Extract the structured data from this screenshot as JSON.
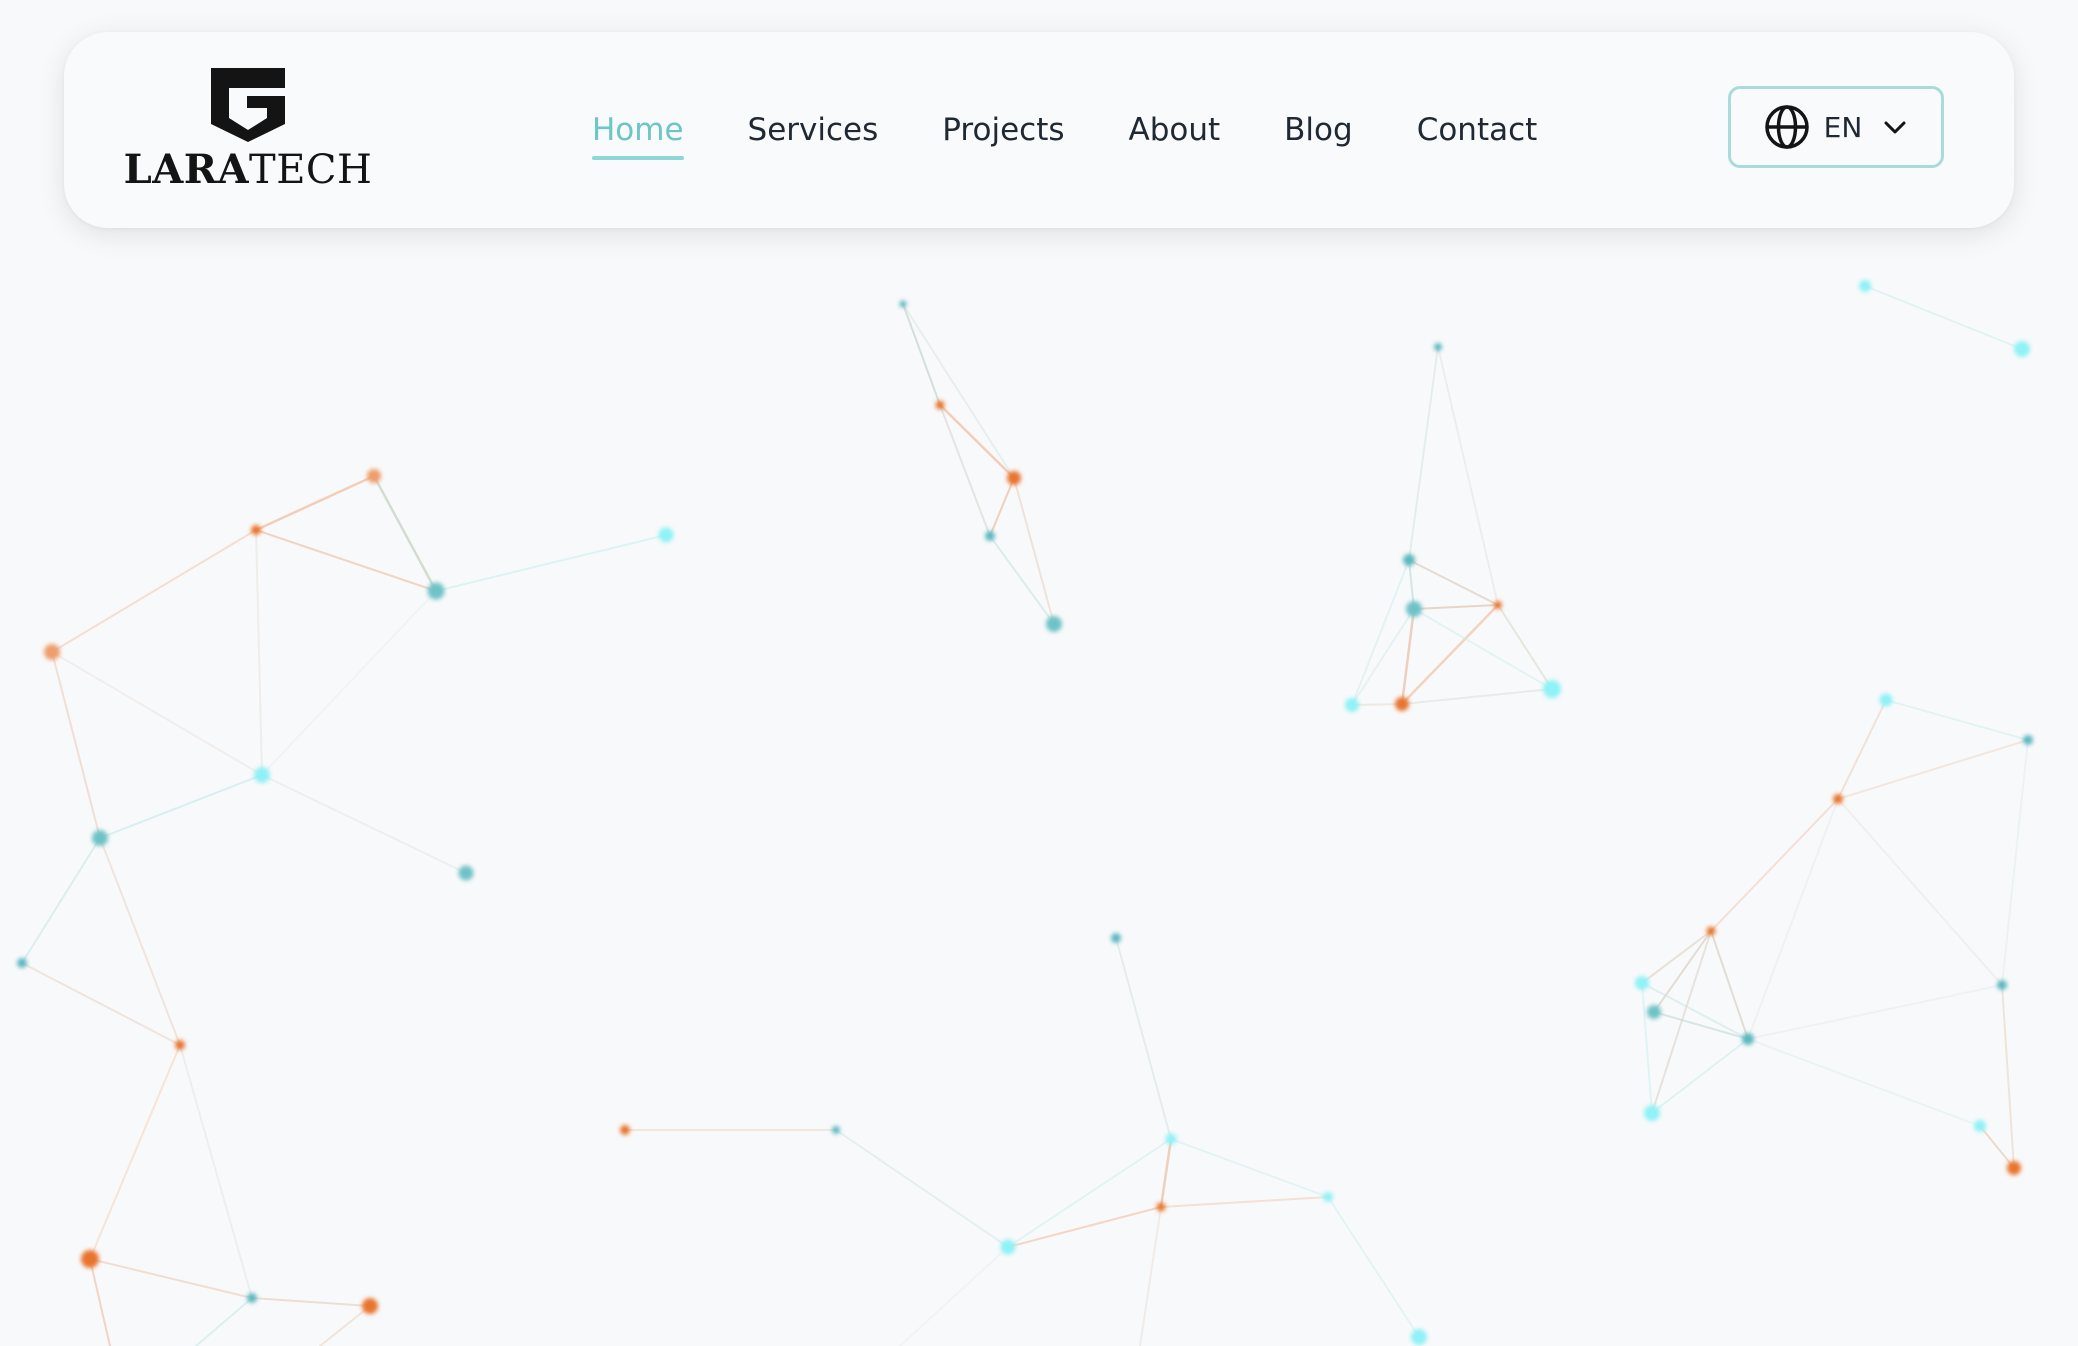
{
  "brand": {
    "name_bold": "LARA",
    "name_light": "TECH"
  },
  "nav": {
    "items": [
      {
        "label": "Home",
        "active": true
      },
      {
        "label": "Services",
        "active": false
      },
      {
        "label": "Projects",
        "active": false
      },
      {
        "label": "About",
        "active": false
      },
      {
        "label": "Blog",
        "active": false
      },
      {
        "label": "Contact",
        "active": false
      }
    ]
  },
  "language": {
    "label": "EN",
    "icon": "globe-icon",
    "dropdown_icon": "chevron-down-icon"
  },
  "colors": {
    "accent": "#6cc6c6",
    "background": "#f8f9fa",
    "node_orange": "#e8742e",
    "node_teal": "#5bb8bf",
    "node_cyan": "#7ff0f5"
  }
}
